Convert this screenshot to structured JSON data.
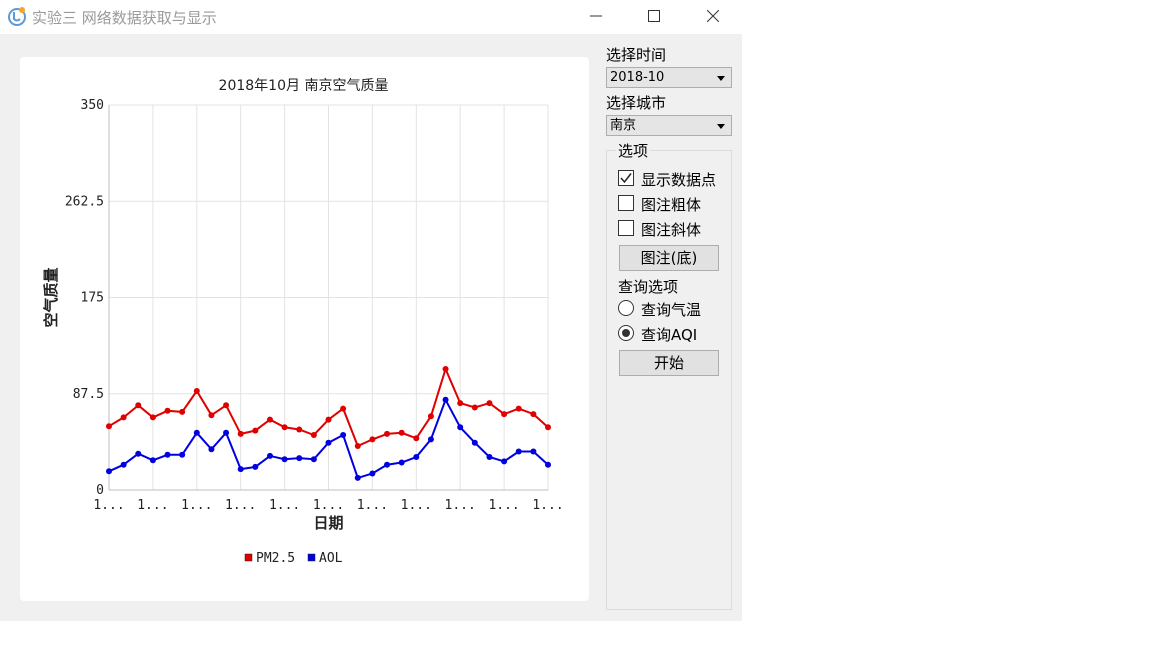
{
  "window": {
    "title": "实验三 网络数据获取与显示"
  },
  "sidebar": {
    "time_label": "选择时间",
    "time_value": "2018-10",
    "city_label": "选择城市",
    "city_value": "南京",
    "options_title": "选项",
    "show_points_label": "显示数据点",
    "show_points_checked": true,
    "bold_label": "图注粗体",
    "bold_checked": false,
    "italic_label": "图注斜体",
    "italic_checked": false,
    "legend_button": "图注(底)",
    "query_title": "查询选项",
    "query_temp_label": "查询气温",
    "query_aqi_label": "查询AQI",
    "query_selected": "查询AQI",
    "start_button": "开始"
  },
  "chart_data": {
    "type": "line",
    "title": "2018年10月 南京空气质量",
    "xlabel": "日期",
    "ylabel": "空气质量",
    "ylim": [
      0,
      350
    ],
    "y_ticks": [
      "0",
      "87.5",
      "175",
      "262.5",
      "350"
    ],
    "x_tick_labels": [
      "1...",
      "1...",
      "1...",
      "1...",
      "1...",
      "1...",
      "1...",
      "1...",
      "1...",
      "1...",
      "1..."
    ],
    "grid": true,
    "legend_position": "bottom",
    "colors": {
      "PM2.5": "#e00000",
      "AOL": "#0000e0"
    },
    "series": [
      {
        "name": "PM2.5",
        "values": [
          58,
          66,
          77,
          66,
          72,
          71,
          90,
          68,
          77,
          51,
          54,
          64,
          57,
          55,
          50,
          64,
          74,
          40,
          46,
          51,
          52,
          47,
          67,
          110,
          79,
          75,
          79,
          69,
          74,
          69,
          57
        ]
      },
      {
        "name": "AOL",
        "values": [
          17,
          23,
          33,
          27,
          32,
          32,
          52,
          37,
          52,
          19,
          21,
          31,
          28,
          29,
          28,
          43,
          50,
          11,
          15,
          23,
          25,
          30,
          46,
          82,
          57,
          43,
          30,
          26,
          35,
          35,
          23
        ]
      }
    ]
  }
}
